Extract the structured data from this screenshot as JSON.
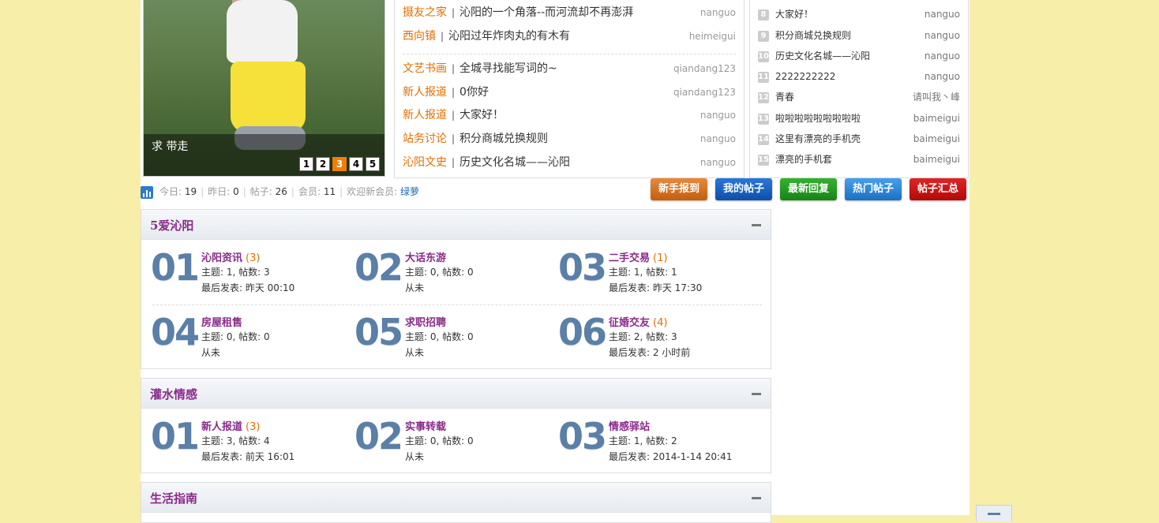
{
  "slider": {
    "caption": "求 带走",
    "pages": [
      "1",
      "2",
      "3",
      "4",
      "5"
    ],
    "active_page": 2
  },
  "threads": [
    {
      "cat": "摄友之家",
      "title": "沁阳的一个角落--而河流却不再澎湃",
      "author": "nanguo"
    },
    {
      "cat": "西向镇",
      "title": "沁阳过年炸肉丸的有木有",
      "author": "heimeigui"
    },
    {
      "cat": "文艺书画",
      "title": "全城寻找能写词的~",
      "author": "qiandang123"
    },
    {
      "cat": "新人报道",
      "title": "0你好",
      "author": "qiandang123"
    },
    {
      "cat": "新人报道",
      "title": "大家好！",
      "author": "nanguo"
    },
    {
      "cat": "站务讨论",
      "title": "积分商城兑换规则",
      "author": "nanguo"
    },
    {
      "cat": "沁阳文史",
      "title": "历史文化名城——沁阳",
      "author": "nanguo"
    }
  ],
  "rank": [
    {
      "num": "8",
      "title": "大家好！",
      "author": "nanguo"
    },
    {
      "num": "9",
      "title": "积分商城兑换规则",
      "author": "nanguo"
    },
    {
      "num": "10",
      "title": "历史文化名城——沁阳",
      "author": "nanguo"
    },
    {
      "num": "11",
      "title": "2222222222",
      "author": "nanguo"
    },
    {
      "num": "12",
      "title": "青春",
      "author": "请叫我丶峰"
    },
    {
      "num": "13",
      "title": "啦啦啦啦啦啦啦啦啦",
      "author": "baimeigui"
    },
    {
      "num": "14",
      "title": "这里有漂亮的手机壳",
      "author": "baimeigui"
    },
    {
      "num": "15",
      "title": "漂亮的手机套",
      "author": "baimeigui"
    }
  ],
  "stats": {
    "today_label": "今日:",
    "today": "19",
    "yesterday_label": "昨日:",
    "yesterday": "0",
    "posts_label": "帖子:",
    "posts": "26",
    "members_label": "会员:",
    "members": "11",
    "welcome_label": "欢迎新会员:",
    "newest_member": "绿萝"
  },
  "buttons": [
    {
      "label": "新手报到",
      "color": "#d9721c"
    },
    {
      "label": "我的帖子",
      "color": "#1760c2"
    },
    {
      "label": "最新回复",
      "color": "#22991f"
    },
    {
      "label": "热门帖子",
      "color": "#2e86d6"
    },
    {
      "label": "帖子汇总",
      "color": "#cc1111"
    }
  ],
  "sections": [
    {
      "title": "5爱沁阳",
      "forums": [
        {
          "num": "01",
          "name": "沁阳资讯",
          "count": "(3)",
          "stats": "主题: 1, 帖数: 3",
          "last": "最后发表: 昨天 00:10"
        },
        {
          "num": "02",
          "name": "大话东游",
          "count": "",
          "stats": "主题: 0, 帖数: 0",
          "last": "从未"
        },
        {
          "num": "03",
          "name": "二手交易",
          "count": "(1)",
          "stats": "主题: 1, 帖数: 1",
          "last": "最后发表: 昨天 17:30"
        },
        {
          "num": "04",
          "name": "房屋租售",
          "count": "",
          "stats": "主题: 0, 帖数: 0",
          "last": "从未"
        },
        {
          "num": "05",
          "name": "求职招聘",
          "count": "",
          "stats": "主题: 0, 帖数: 0",
          "last": "从未"
        },
        {
          "num": "06",
          "name": "征婚交友",
          "count": "(4)",
          "stats": "主题: 2, 帖数: 3",
          "last": "最后发表: 2 小时前"
        }
      ]
    },
    {
      "title": "灌水情感",
      "forums": [
        {
          "num": "01",
          "name": "新人报道",
          "count": "(3)",
          "stats": "主题: 3, 帖数: 4",
          "last": "最后发表: 前天 16:01"
        },
        {
          "num": "02",
          "name": "实事转载",
          "count": "",
          "stats": "主题: 0, 帖数: 0",
          "last": "从未"
        },
        {
          "num": "03",
          "name": "情感驿站",
          "count": "",
          "stats": "主题: 1, 帖数: 2",
          "last": "最后发表: 2014-1-14 20:41"
        }
      ]
    },
    {
      "title": "生活指南",
      "forums": []
    }
  ]
}
